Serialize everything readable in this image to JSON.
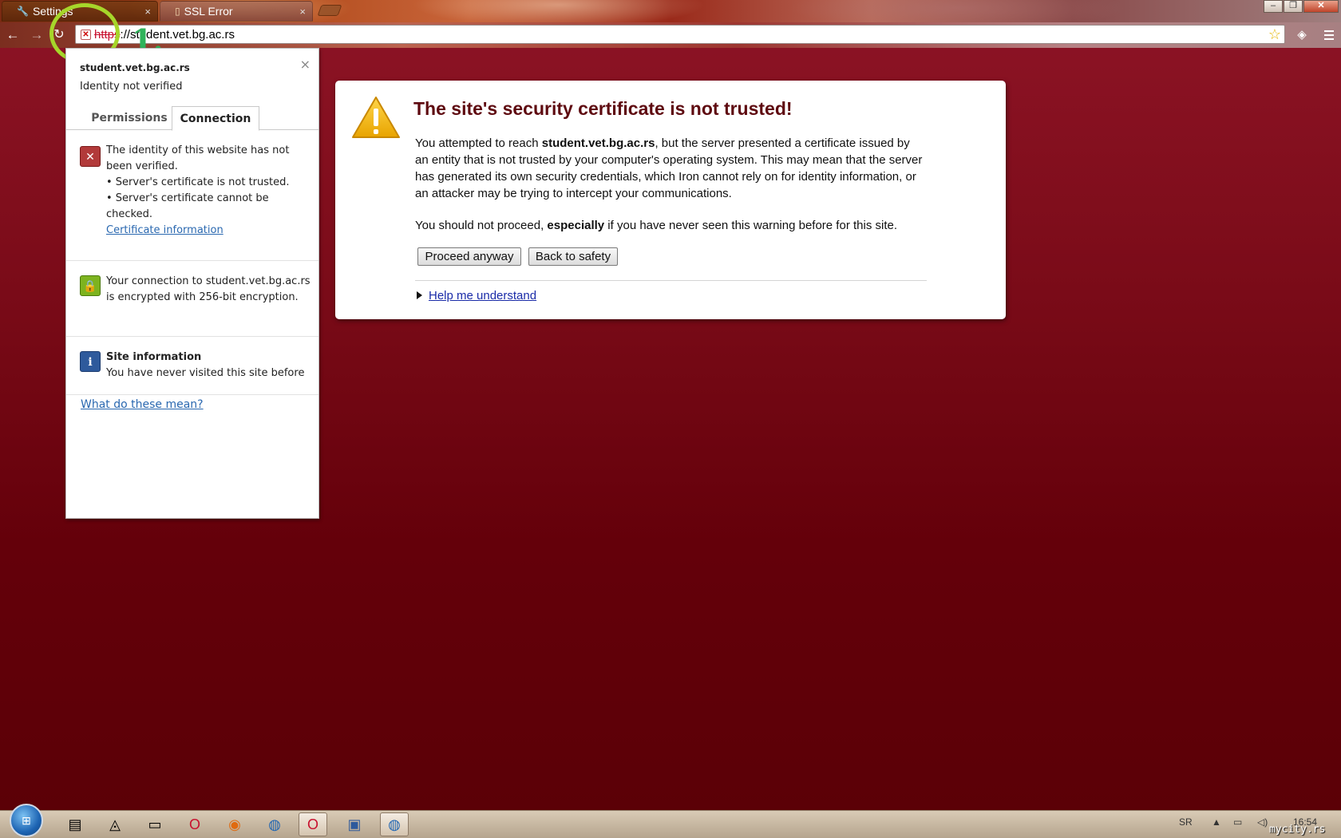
{
  "browser": {
    "tabs": [
      {
        "label": "Settings",
        "icon": "wrench-icon"
      },
      {
        "label": "SSL Error",
        "icon": "page-icon"
      }
    ],
    "url": {
      "scheme": "https",
      "separator": "://",
      "host": "student.vet.bg.ac.rs"
    }
  },
  "annotation": {
    "label": "1.",
    "circle_color": "#a6d62a",
    "label_color": "#2fb35a"
  },
  "site_info": {
    "host": "student.vet.bg.ac.rs",
    "identity_status": "Identity not verified",
    "tabs": [
      "Permissions",
      "Connection"
    ],
    "active_tab": "Connection",
    "identity_section": {
      "line1": "The identity of this website has not been verified.",
      "bullet1": "• Server's certificate is not trusted.",
      "bullet2": "• Server's certificate cannot be checked.",
      "link": "Certificate information"
    },
    "connection_section": {
      "text": "Your connection to student.vet.bg.ac.rs is encrypted with 256-bit encryption."
    },
    "site_section": {
      "title": "Site information",
      "text": "You have never visited this site before"
    },
    "footer_link": "What do these mean?"
  },
  "interstitial": {
    "heading": "The site's security certificate is not trusted!",
    "para1_prefix": "You attempted to reach ",
    "para1_host": "student.vet.bg.ac.rs",
    "para1_suffix": ", but the server presented a certificate issued by an entity that is not trusted by your computer's operating system. This may mean that the server has generated its own security credentials, which Iron cannot rely on for identity information, or an attacker may be trying to intercept your communications.",
    "para2_prefix": "You should not proceed, ",
    "para2_bold": "especially",
    "para2_suffix": " if you have never seen this warning before for this site.",
    "proceed_button": "Proceed anyway",
    "back_button": "Back to safety",
    "help_link": "Help me understand",
    "heading_color": "#5e0a10"
  },
  "taskbar": {
    "language": "SR",
    "clock": "16:54",
    "watermark": "mycity.rs"
  }
}
